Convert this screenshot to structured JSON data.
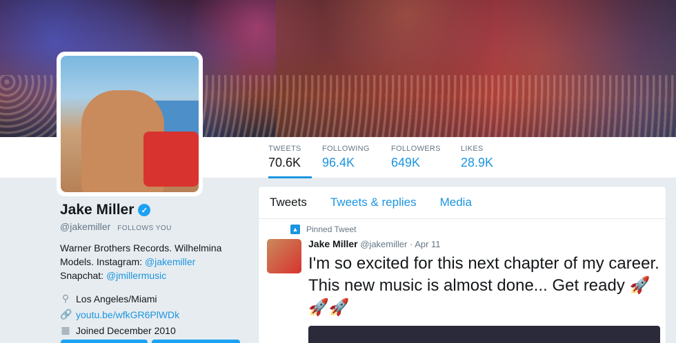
{
  "stats": [
    {
      "label": "TWEETS",
      "value": "70.6K"
    },
    {
      "label": "FOLLOWING",
      "value": "96.4K"
    },
    {
      "label": "FOLLOWERS",
      "value": "649K"
    },
    {
      "label": "LIKES",
      "value": "28.9K"
    }
  ],
  "profile": {
    "name": "Jake Miller",
    "handle": "@jakemiller",
    "follows_you": "FOLLOWS YOU",
    "bio_line1": "Warner Brothers Records. Wilhelmina",
    "bio_line2_text": "Models. Instagram: ",
    "bio_instagram": "@jakemiller",
    "bio_line3_text": "Snapchat: ",
    "bio_snapchat": "@jmillermusic",
    "location": "Los Angeles/Miami",
    "website": "youtu.be/wfkGR6PlWDk",
    "joined": "Joined December 2010"
  },
  "tabs": [
    "Tweets",
    "Tweets & replies",
    "Media"
  ],
  "tweet": {
    "pinned_label": "Pinned Tweet",
    "author": "Jake Miller",
    "handle": "@jakemiller",
    "date": "· Apr 11",
    "text": "I'm so excited for this next chapter of my career. This new music is almost done... Get ready",
    "emoji": "🚀"
  },
  "colors": {
    "accent": "#1b95e0",
    "verified": "#1da1f2"
  },
  "icons": {
    "verified": "verified-badge-icon",
    "location": "location-pin-icon",
    "link": "link-icon",
    "calendar": "calendar-icon",
    "pin": "pin-icon"
  }
}
